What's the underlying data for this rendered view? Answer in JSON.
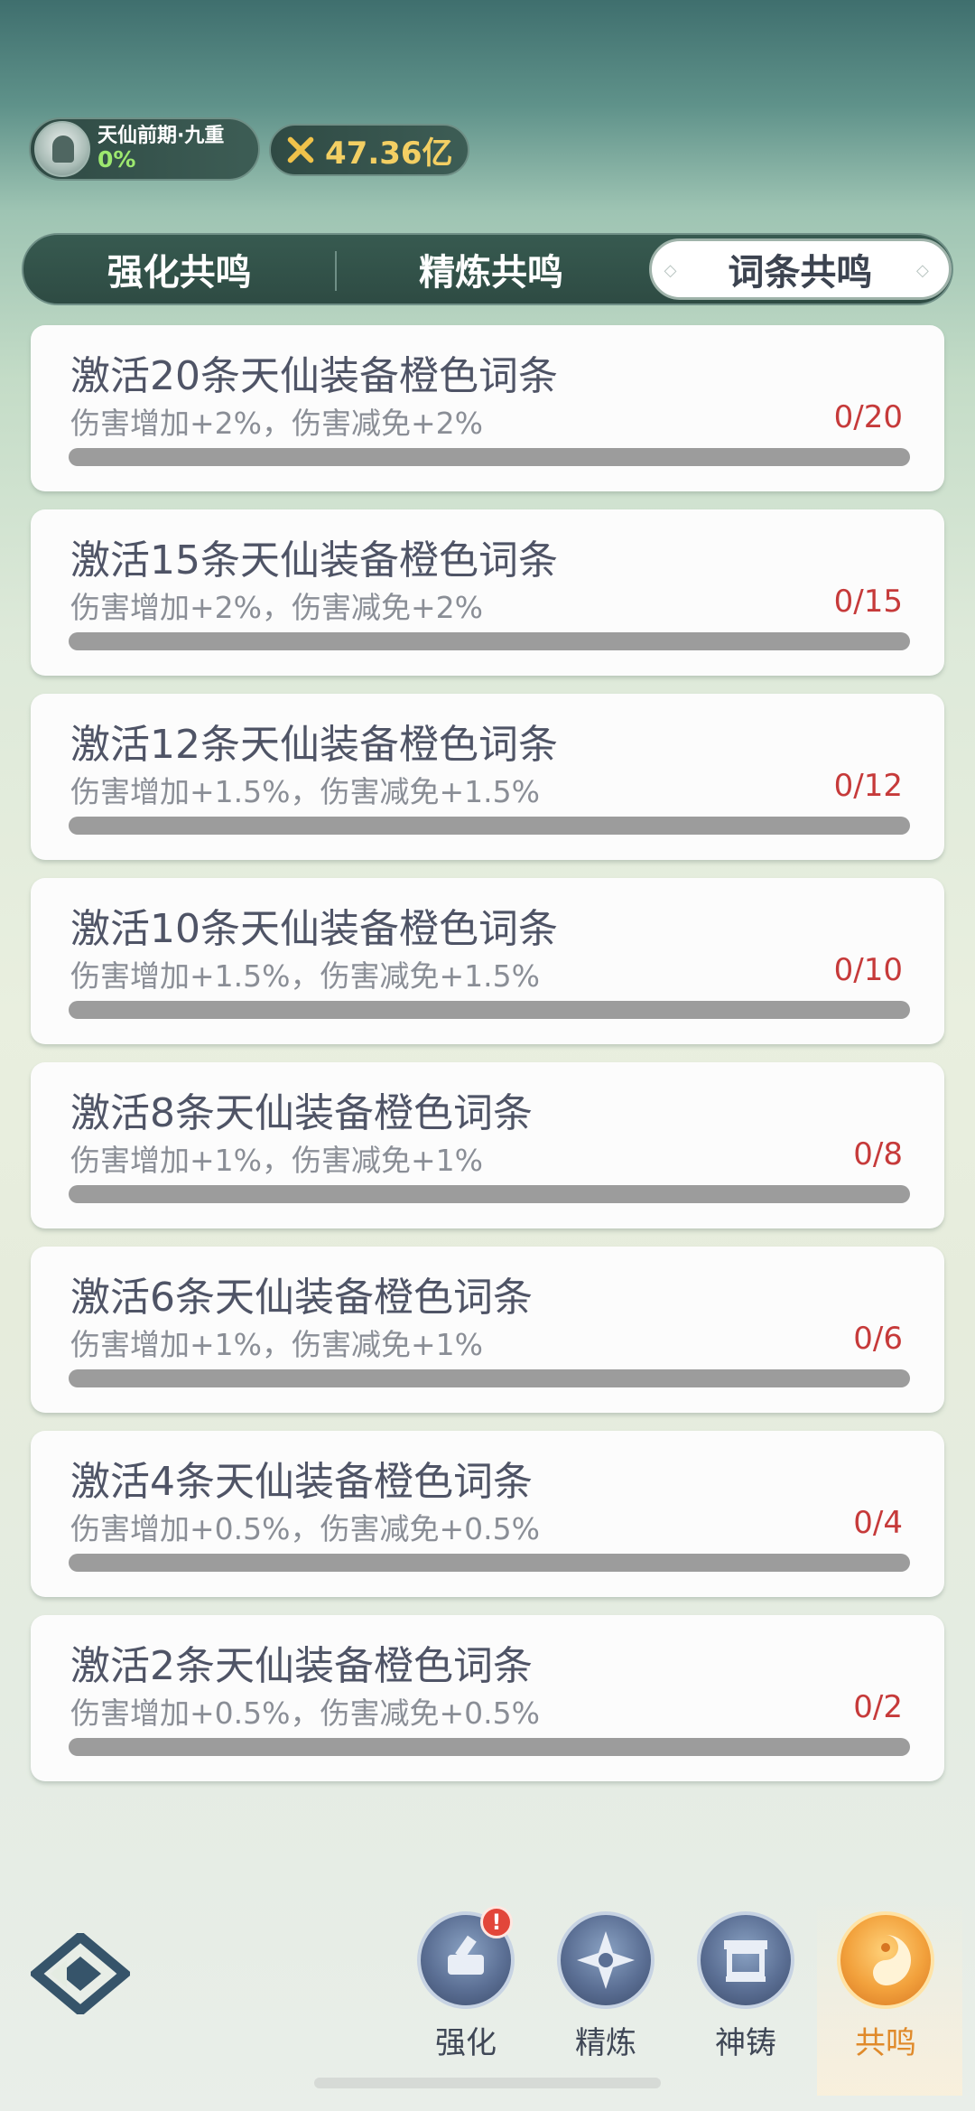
{
  "header": {
    "realm_name": "天仙前期·九重",
    "realm_progress": "0%",
    "power_value": "47.36亿"
  },
  "tabs": [
    {
      "label": "强化共鸣",
      "active": false
    },
    {
      "label": "精炼共鸣",
      "active": false
    },
    {
      "label": "词条共鸣",
      "active": true
    }
  ],
  "cards": [
    {
      "title": "激活20条天仙装备橙色词条",
      "effect": "伤害增加+2%，伤害减免+2%",
      "count": "0/20",
      "progress": 0
    },
    {
      "title": "激活15条天仙装备橙色词条",
      "effect": "伤害增加+2%，伤害减免+2%",
      "count": "0/15",
      "progress": 0
    },
    {
      "title": "激活12条天仙装备橙色词条",
      "effect": "伤害增加+1.5%，伤害减免+1.5%",
      "count": "0/12",
      "progress": 0
    },
    {
      "title": "激活10条天仙装备橙色词条",
      "effect": "伤害增加+1.5%，伤害减免+1.5%",
      "count": "0/10",
      "progress": 0
    },
    {
      "title": "激活8条天仙装备橙色词条",
      "effect": "伤害增加+1%，伤害减免+1%",
      "count": "0/8",
      "progress": 0
    },
    {
      "title": "激活6条天仙装备橙色词条",
      "effect": "伤害增加+1%，伤害减免+1%",
      "count": "0/6",
      "progress": 0
    },
    {
      "title": "激活4条天仙装备橙色词条",
      "effect": "伤害增加+0.5%，伤害减免+0.5%",
      "count": "0/4",
      "progress": 0
    },
    {
      "title": "激活2条天仙装备橙色词条",
      "effect": "伤害增加+0.5%，伤害减免+0.5%",
      "count": "0/2",
      "progress": 0
    }
  ],
  "nav": [
    {
      "label": "强化",
      "icon": "enhance-icon",
      "alert": "!"
    },
    {
      "label": "精炼",
      "icon": "refine-icon"
    },
    {
      "label": "神铸",
      "icon": "divine-forge-icon"
    },
    {
      "label": "共鸣",
      "icon": "resonance-icon",
      "active": true
    }
  ],
  "colors": {
    "accent_active": "#e08a2a",
    "count_red": "#c63a3a",
    "power_gold": "#f3cf63",
    "realm_green": "#9de86f"
  }
}
